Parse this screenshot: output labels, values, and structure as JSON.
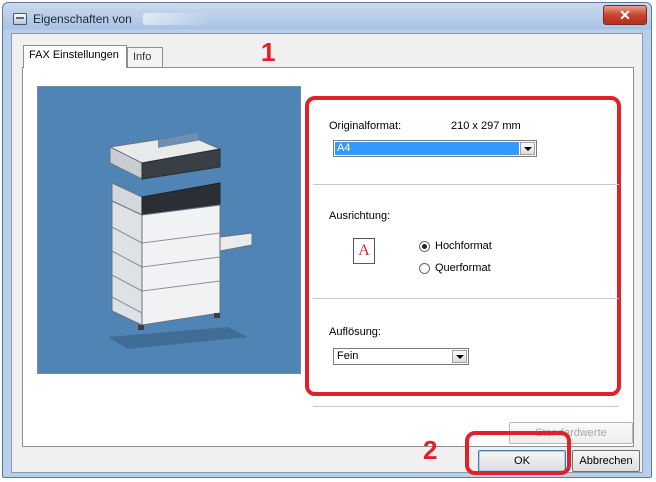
{
  "window": {
    "title": "Eigenschaften von",
    "close_glyph": "✕"
  },
  "tabs": [
    {
      "label": "FAX Einstellungen",
      "active": true
    },
    {
      "label": "Info",
      "active": false
    }
  ],
  "original_format": {
    "label": "Originalformat:",
    "size_text": "210 x 297 mm",
    "selected": "A4"
  },
  "orientation": {
    "label": "Ausrichtung:",
    "icon_letter": "A",
    "options": [
      {
        "label": "Hochformat",
        "checked": true
      },
      {
        "label": "Querformat",
        "checked": false
      }
    ]
  },
  "resolution": {
    "label": "Auflösung:",
    "selected": "Fein"
  },
  "buttons": {
    "defaults": "Standardwerte",
    "ok": "OK",
    "cancel": "Abbrechen"
  },
  "callouts": {
    "one": "1",
    "two": "2"
  },
  "colors": {
    "accent_red": "#e0202a",
    "preview_bg": "#4f84b4",
    "selection_blue": "#3399ff"
  }
}
